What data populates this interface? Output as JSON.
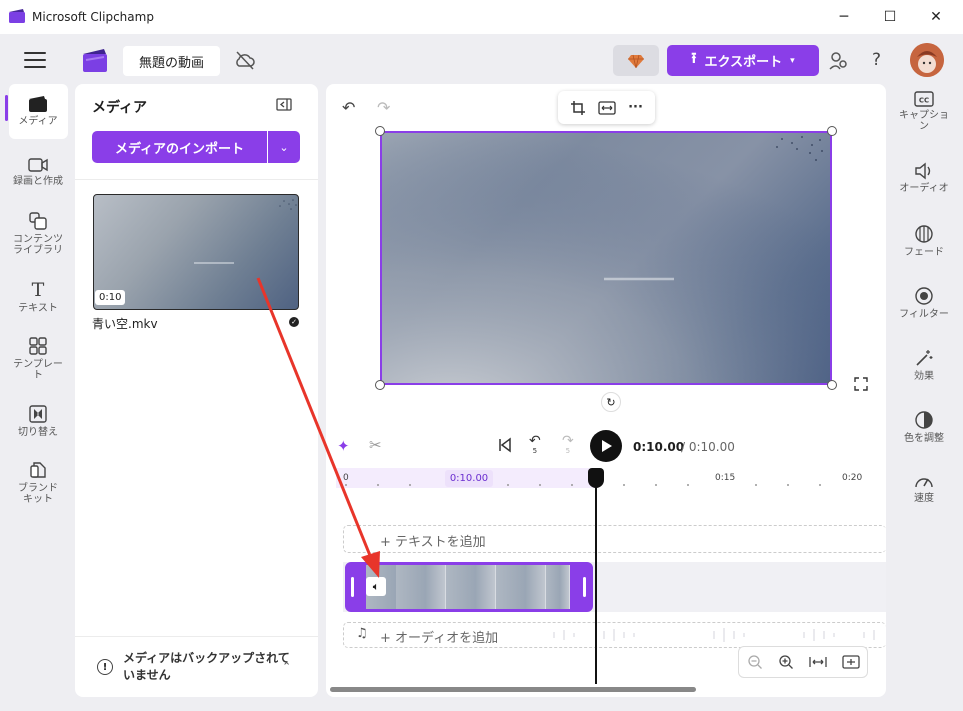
{
  "window": {
    "title": "Microsoft Clipchamp",
    "minimize": "─",
    "maximize": "☐",
    "close": "✕"
  },
  "header": {
    "project_title": "無題の動画",
    "export_label": "エクスポート",
    "help": "?"
  },
  "left_rail": [
    {
      "label": "メディア",
      "icon": "film-icon"
    },
    {
      "label": "録画と作成",
      "icon": "camera-icon"
    },
    {
      "label": "コンテンツ\nライブラリ",
      "icon": "library-icon"
    },
    {
      "label": "テキスト",
      "icon": "text-icon"
    },
    {
      "label": "テンプレー\nト",
      "icon": "template-icon"
    },
    {
      "label": "切り替え",
      "icon": "transition-icon"
    },
    {
      "label": "ブランド\nキット",
      "icon": "brand-kit-icon"
    }
  ],
  "media_panel": {
    "title": "メディア",
    "import_label": "メディアのインポート",
    "items": [
      {
        "name": "青い空.mkv",
        "duration": "0:10"
      }
    ],
    "backup_notice": "メディアはバックアップされていません"
  },
  "preview": {
    "toolbar": [
      "crop-icon",
      "fit-icon",
      "more-icon"
    ],
    "more_label": "···"
  },
  "timeline": {
    "time_current": "0:10.00",
    "time_total": "/ 0:10.00",
    "ruler_badge": "0:10.00",
    "ruler_ticks": [
      "0",
      "0:15",
      "0:20"
    ],
    "text_track_label": "+ テキストを追加",
    "audio_track_label": "+ オーディオを追加",
    "rewind_label": "5",
    "forward_label": "5"
  },
  "right_rail": [
    {
      "label": "キャプショ\nン",
      "icon": "cc-icon"
    },
    {
      "label": "オーディオ",
      "icon": "speaker-icon"
    },
    {
      "label": "フェード",
      "icon": "fade-icon"
    },
    {
      "label": "フィルター",
      "icon": "filter-icon"
    },
    {
      "label": "効果",
      "icon": "effects-icon"
    },
    {
      "label": "色を調整",
      "icon": "color-adjust-icon"
    },
    {
      "label": "速度",
      "icon": "speed-icon"
    }
  ],
  "colors": {
    "accent": "#8a3ee8",
    "annotation_arrow": "#e8352a"
  }
}
